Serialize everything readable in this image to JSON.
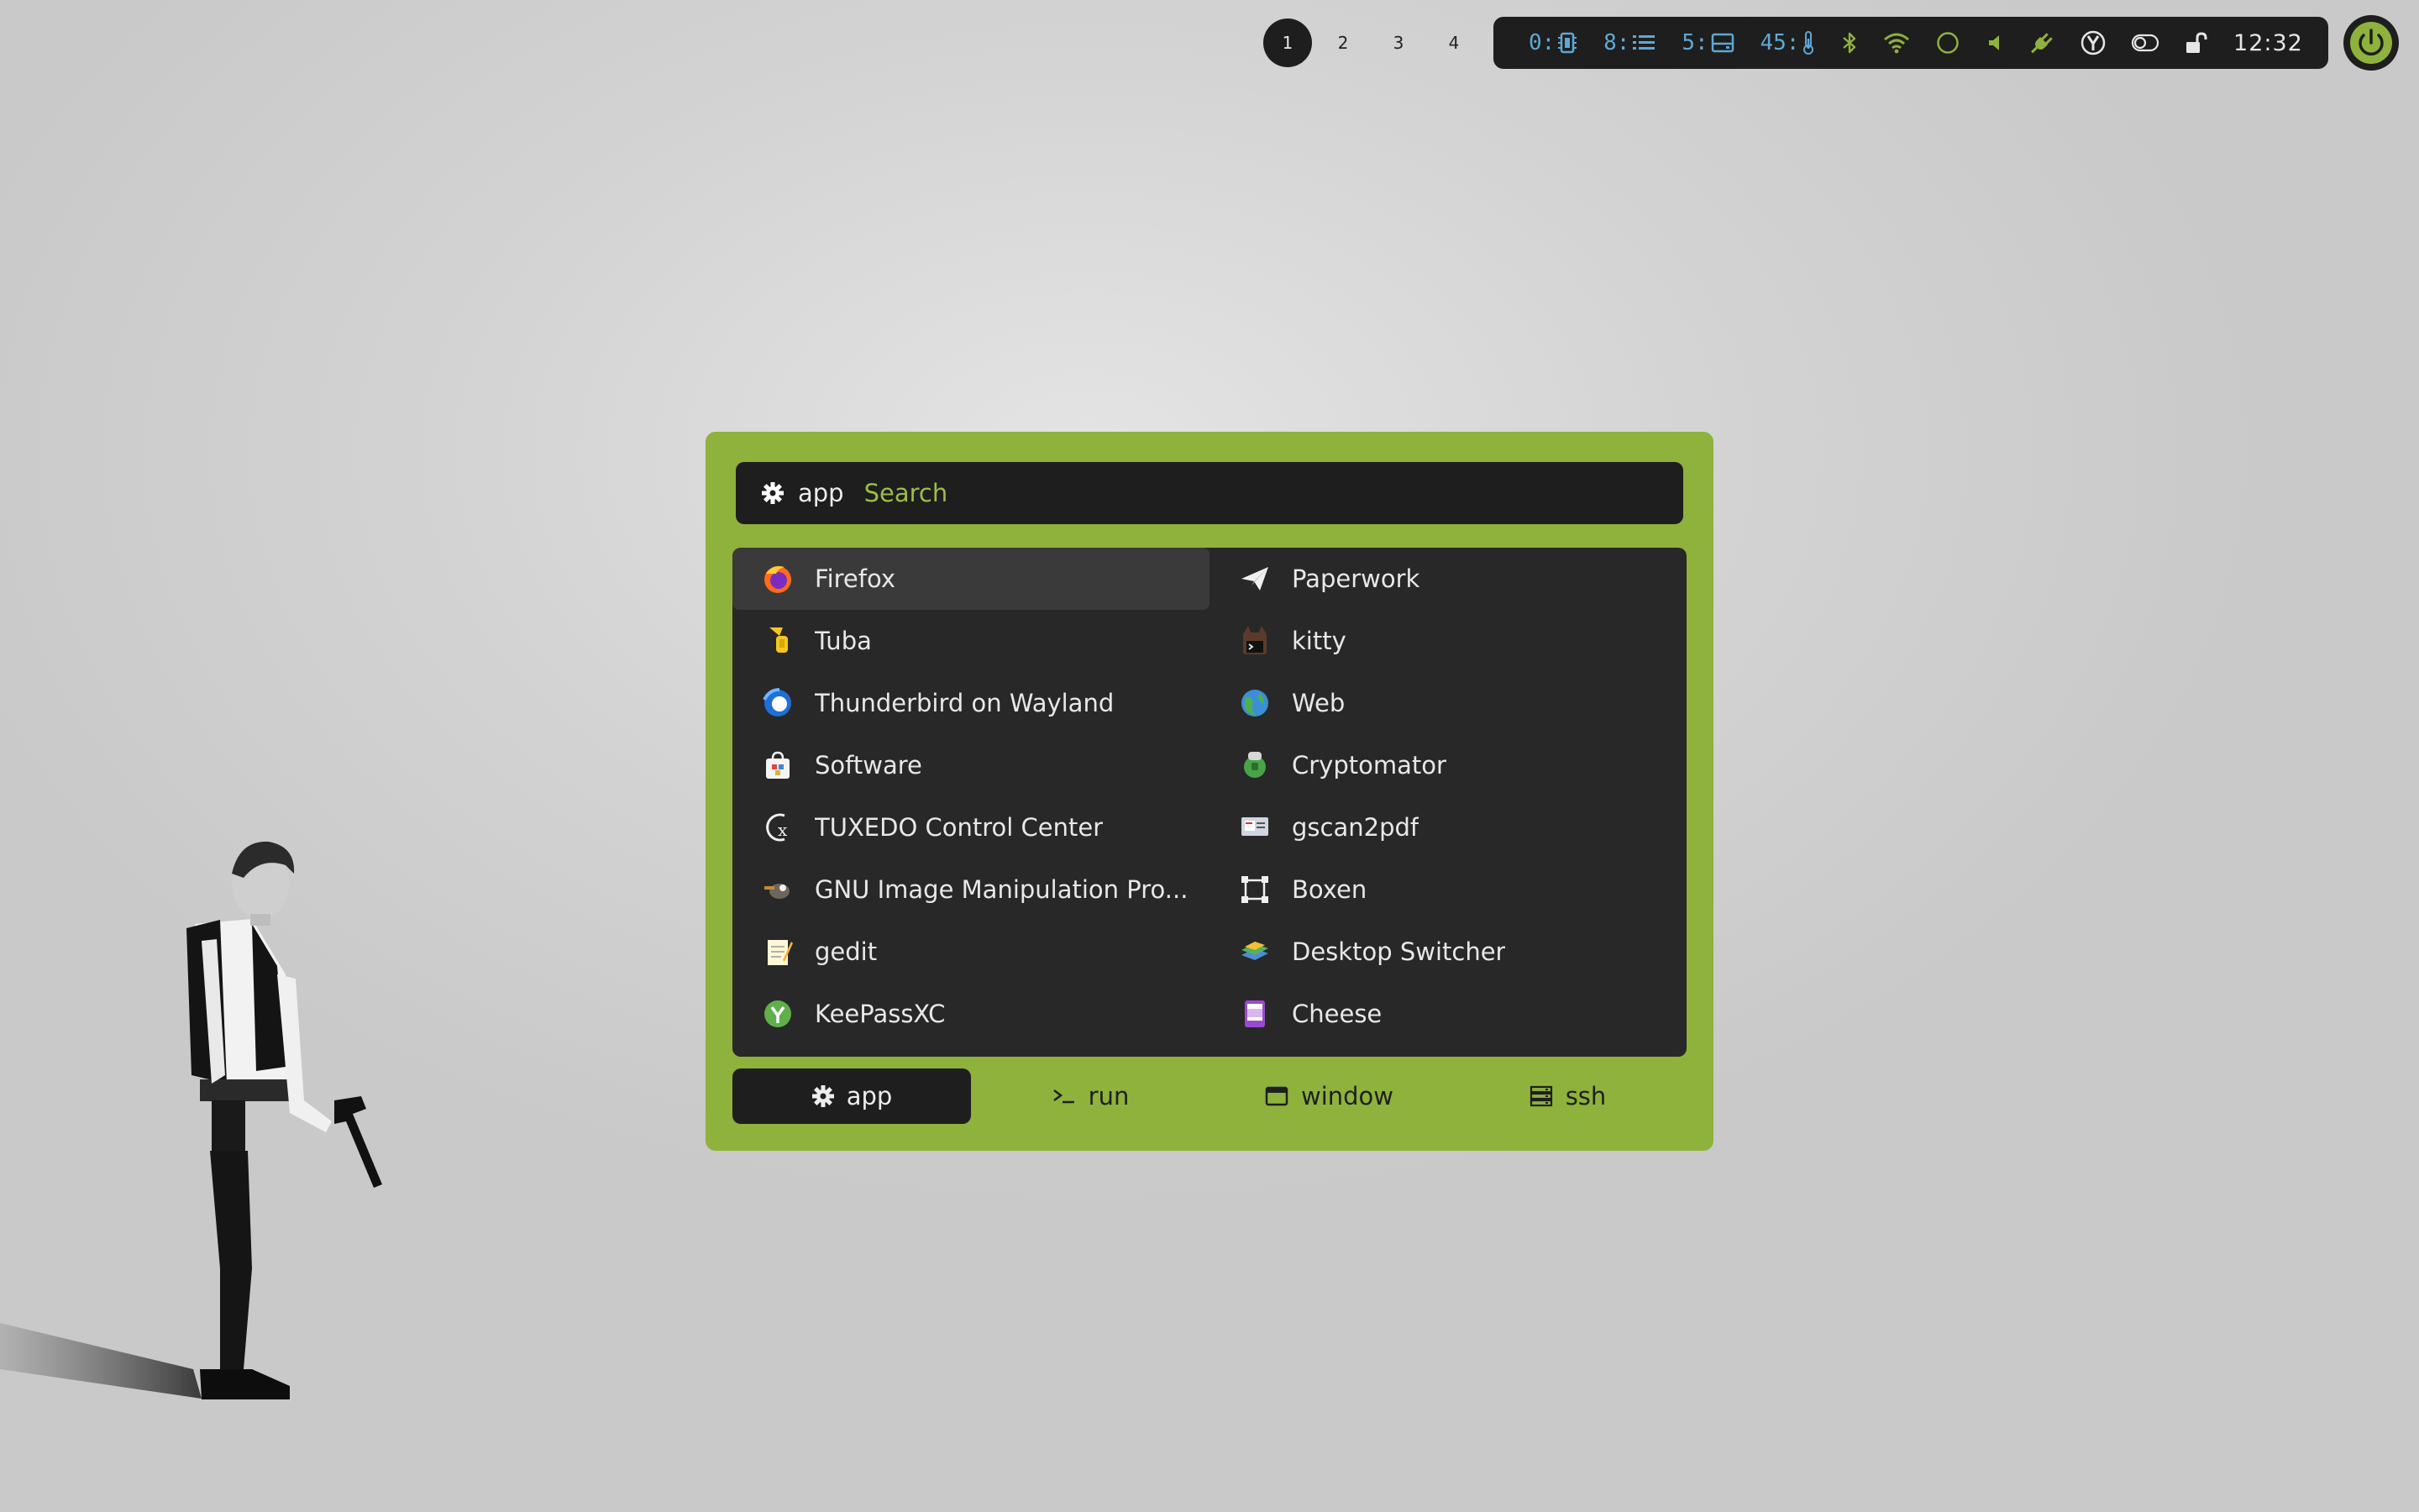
{
  "workspaces": [
    "1",
    "2",
    "3",
    "4"
  ],
  "active_workspace": "1",
  "status": {
    "cpu": "0:",
    "memory": "8:",
    "disk": "5:",
    "temperature": "45:",
    "clock": "12:32",
    "accent_color": "#5fa8d3",
    "green_color": "#8eb23c",
    "icons": [
      "bluetooth-icon",
      "wifi-icon",
      "circle-icon",
      "volume-icon",
      "power-plug-icon",
      "yubikey-icon",
      "toggle-icon",
      "unlock-icon"
    ]
  },
  "launcher": {
    "mode_label": "app",
    "search_placeholder": "Search",
    "items": [
      {
        "label": "Firefox",
        "icon": "firefox-icon"
      },
      {
        "label": "Paperwork",
        "icon": "paper-plane-icon"
      },
      {
        "label": "Tuba",
        "icon": "tuba-icon"
      },
      {
        "label": "kitty",
        "icon": "kitty-icon"
      },
      {
        "label": "Thunderbird on Wayland",
        "icon": "thunderbird-icon"
      },
      {
        "label": "Web",
        "icon": "globe-icon"
      },
      {
        "label": "Software",
        "icon": "software-bag-icon"
      },
      {
        "label": "Cryptomator",
        "icon": "cryptomator-icon"
      },
      {
        "label": "TUXEDO Control Center",
        "icon": "tuxedo-icon"
      },
      {
        "label": "gscan2pdf",
        "icon": "scanner-icon"
      },
      {
        "label": "GNU Image Manipulation Pro...",
        "icon": "gimp-icon"
      },
      {
        "label": "Boxen",
        "icon": "boxen-icon"
      },
      {
        "label": "gedit",
        "icon": "text-editor-icon"
      },
      {
        "label": "Desktop Switcher",
        "icon": "desktop-switcher-icon"
      },
      {
        "label": "KeePassXC",
        "icon": "keepass-icon"
      },
      {
        "label": "Cheese",
        "icon": "cheese-icon"
      }
    ],
    "tabs": [
      {
        "label": "app",
        "icon": "gear-icon"
      },
      {
        "label": "run",
        "icon": "terminal-prompt-icon"
      },
      {
        "label": "window",
        "icon": "window-icon"
      },
      {
        "label": "ssh",
        "icon": "server-icon"
      }
    ],
    "active_tab": "app"
  }
}
